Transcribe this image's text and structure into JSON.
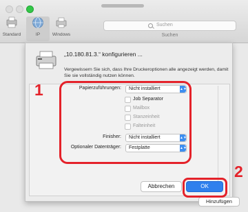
{
  "toolbar": {
    "items": [
      {
        "label": "Standard",
        "icon": "standard-printer-icon"
      },
      {
        "label": "IP",
        "icon": "ip-globe-icon"
      },
      {
        "label": "Windows",
        "icon": "windows-printer-icon"
      }
    ],
    "search_placeholder": "Suchen",
    "search_label": "Suchen"
  },
  "dialog": {
    "title": "„10.180.81.3.“ konfigurieren ...",
    "message": "Vergewissern Sie sich, dass Ihre Druckeroptionen alle angezeigt werden, damit Sie sie vollständig nutzen können.",
    "options": {
      "paper_feeder_label": "Papierzuführungen:",
      "paper_feeder_value": "Nicht installiert",
      "checkboxes": [
        {
          "label": "Job Separator",
          "enabled": true
        },
        {
          "label": "Mailbox",
          "enabled": false
        },
        {
          "label": "Stanzeinheit",
          "enabled": false
        },
        {
          "label": "Falteinheit",
          "enabled": false
        }
      ],
      "finisher_label": "Finisher:",
      "finisher_value": "Nicht installiert",
      "storage_label": "Optionaler Datenträger:",
      "storage_value": "Festplatte"
    },
    "cancel_label": "Abbrechen",
    "ok_label": "OK"
  },
  "add_label": "Hinzufügen",
  "callouts": {
    "one": "1",
    "two": "2",
    "color": "#e4222a"
  },
  "colors": {
    "accent": "#2f80ed"
  }
}
